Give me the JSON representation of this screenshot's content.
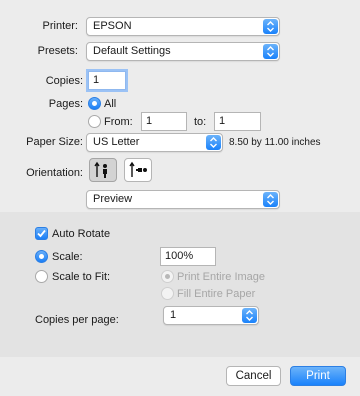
{
  "printer": {
    "label": "Printer:",
    "value": "EPSON"
  },
  "presets": {
    "label": "Presets:",
    "value": "Default Settings"
  },
  "copies": {
    "label": "Copies:",
    "value": "1"
  },
  "pages": {
    "label": "Pages:",
    "all_label": "All",
    "from_label": "From:",
    "from_value": "1",
    "to_label": "to:",
    "to_value": "1",
    "selected": "All"
  },
  "paper_size": {
    "label": "Paper Size:",
    "value": "US Letter",
    "dimensions": "8.50 by 11.00 inches"
  },
  "orientation": {
    "label": "Orientation:",
    "selected": "portrait"
  },
  "section_popup": {
    "value": "Preview"
  },
  "auto_rotate": {
    "label": "Auto Rotate",
    "checked": true
  },
  "scale": {
    "label": "Scale:",
    "value": "100%",
    "selected": true
  },
  "scale_to_fit": {
    "label": "Scale to Fit:",
    "print_entire_image_label": "Print Entire Image",
    "fill_entire_paper_label": "Fill Entire Paper"
  },
  "copies_per_page": {
    "label": "Copies per page:",
    "value": "1"
  },
  "buttons": {
    "cancel": "Cancel",
    "print": "Print"
  },
  "colors": {
    "accent": "#1a82fb",
    "background": "#ececec",
    "section_background": "#e3e3e3",
    "disabled_text": "#a6a6a6"
  },
  "icons": [
    "chevron-updown-icon",
    "checkmark-icon",
    "portrait-person-icon",
    "landscape-person-icon"
  ]
}
